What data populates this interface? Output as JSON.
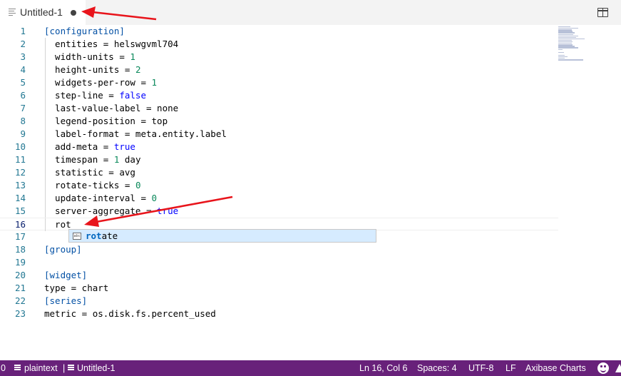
{
  "tab": {
    "title": "Untitled-1",
    "icon": "file-text-icon",
    "dirty": true
  },
  "editor_actions": {
    "split_editor_icon": "split-editor-icon"
  },
  "editor": {
    "lines": [
      {
        "n": "1",
        "tokens": [
          {
            "t": "[configuration]",
            "c": "sec"
          }
        ]
      },
      {
        "n": "2",
        "tokens": [
          {
            "t": "  entities = helswgvml704",
            "c": ""
          }
        ]
      },
      {
        "n": "3",
        "tokens": [
          {
            "t": "  width-units = ",
            "c": ""
          },
          {
            "t": "1",
            "c": "num"
          }
        ]
      },
      {
        "n": "4",
        "tokens": [
          {
            "t": "  height-units = ",
            "c": ""
          },
          {
            "t": "2",
            "c": "num"
          }
        ]
      },
      {
        "n": "5",
        "tokens": [
          {
            "t": "  widgets-per-row = ",
            "c": ""
          },
          {
            "t": "1",
            "c": "num"
          }
        ]
      },
      {
        "n": "6",
        "tokens": [
          {
            "t": "  step-line = ",
            "c": ""
          },
          {
            "t": "false",
            "c": "kw"
          }
        ]
      },
      {
        "n": "7",
        "tokens": [
          {
            "t": "  last-value-label = none",
            "c": ""
          }
        ]
      },
      {
        "n": "8",
        "tokens": [
          {
            "t": "  legend-position = top",
            "c": ""
          }
        ]
      },
      {
        "n": "9",
        "tokens": [
          {
            "t": "  label-format = meta.entity.label",
            "c": ""
          }
        ]
      },
      {
        "n": "10",
        "tokens": [
          {
            "t": "  add-meta = ",
            "c": ""
          },
          {
            "t": "true",
            "c": "kw"
          }
        ]
      },
      {
        "n": "11",
        "tokens": [
          {
            "t": "  timespan = ",
            "c": ""
          },
          {
            "t": "1",
            "c": "num"
          },
          {
            "t": " day",
            "c": ""
          }
        ]
      },
      {
        "n": "12",
        "tokens": [
          {
            "t": "  statistic = avg",
            "c": ""
          }
        ]
      },
      {
        "n": "13",
        "tokens": [
          {
            "t": "  rotate-ticks = ",
            "c": ""
          },
          {
            "t": "0",
            "c": "num"
          }
        ]
      },
      {
        "n": "14",
        "tokens": [
          {
            "t": "  update-interval = ",
            "c": ""
          },
          {
            "t": "0",
            "c": "num"
          }
        ]
      },
      {
        "n": "15",
        "tokens": [
          {
            "t": "  server-aggregate = ",
            "c": ""
          },
          {
            "t": "true",
            "c": "kw"
          }
        ]
      },
      {
        "n": "16",
        "tokens": [
          {
            "t": "  rot",
            "c": ""
          }
        ],
        "current": true
      },
      {
        "n": "17",
        "tokens": []
      },
      {
        "n": "18",
        "tokens": [
          {
            "t": "[group]",
            "c": "sec"
          }
        ]
      },
      {
        "n": "19",
        "tokens": []
      },
      {
        "n": "20",
        "tokens": [
          {
            "t": "[widget]",
            "c": "sec"
          }
        ]
      },
      {
        "n": "21",
        "tokens": [
          {
            "t": "type = chart",
            "c": ""
          }
        ]
      },
      {
        "n": "22",
        "tokens": [
          {
            "t": "[series]",
            "c": "sec"
          }
        ]
      },
      {
        "n": "23",
        "tokens": [
          {
            "t": "metric = os.disk.fs.percent_used",
            "c": ""
          }
        ]
      }
    ]
  },
  "suggest": {
    "icon": "text-symbol-icon",
    "icon_text": "abc",
    "match": "rot",
    "rest": "ate"
  },
  "statusbar": {
    "problems_count": "0",
    "language_icon": "file-text-icon",
    "language": "plaintext",
    "separator": "|",
    "file_icon": "file-text-icon",
    "filename": "Untitled-1",
    "cursor": "Ln 16, Col 6",
    "indent": "Spaces: 4",
    "encoding": "UTF-8",
    "eol": "LF",
    "extension": "Axibase Charts",
    "feedback_icon": "smiley-icon",
    "notifications_icon": "bell-icon"
  },
  "colors": {
    "statusbar": "#68217a",
    "line_numbers": "#237893",
    "section": "#0451a5",
    "number": "#09885a",
    "keyword": "#0000ff",
    "suggest_bg": "#d6ebff",
    "annotation_arrow": "#e8141b"
  }
}
